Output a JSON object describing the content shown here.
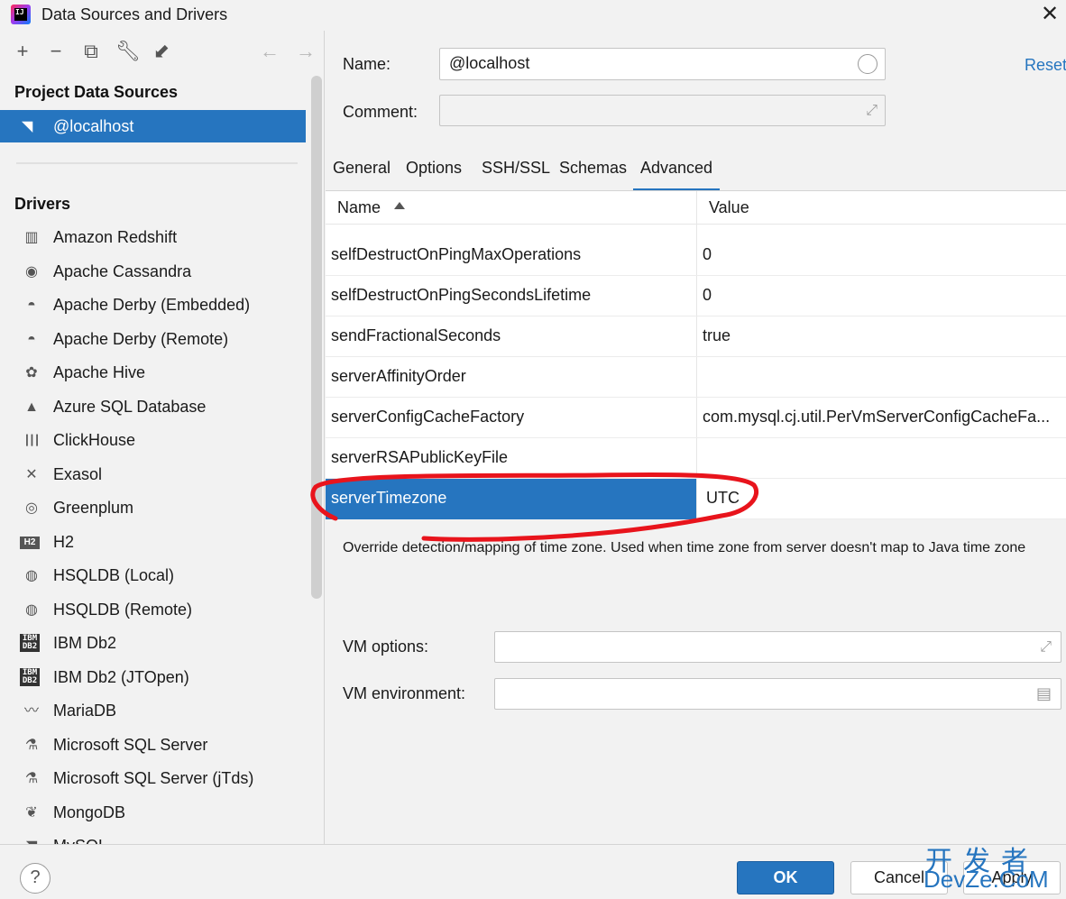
{
  "window": {
    "title": "Data Sources and Drivers",
    "close": "✕"
  },
  "sidebar": {
    "project_heading": "Project Data Sources",
    "selected_source": "@localhost",
    "drivers_heading": "Drivers",
    "drivers": [
      {
        "label": "Amazon Redshift",
        "icon": "redshift-icon",
        "glyph": "▥"
      },
      {
        "label": "Apache Cassandra",
        "icon": "cassandra-eye-icon",
        "glyph": "◉"
      },
      {
        "label": "Apache Derby (Embedded)",
        "icon": "derby-hat-icon",
        "glyph": "◓"
      },
      {
        "label": "Apache Derby (Remote)",
        "icon": "derby-hat-icon",
        "glyph": "◓"
      },
      {
        "label": "Apache Hive",
        "icon": "hive-bee-icon",
        "glyph": "✿"
      },
      {
        "label": "Azure SQL Database",
        "icon": "azure-icon",
        "glyph": "▲"
      },
      {
        "label": "ClickHouse",
        "icon": "clickhouse-bars-icon",
        "glyph": "┃┃┃"
      },
      {
        "label": "Exasol",
        "icon": "exasol-x-icon",
        "glyph": "✕"
      },
      {
        "label": "Greenplum",
        "icon": "greenplum-circle-icon",
        "glyph": "◎"
      },
      {
        "label": "H2",
        "icon": "h2-icon",
        "glyph": "H2"
      },
      {
        "label": "HSQLDB (Local)",
        "icon": "hsqldb-icon",
        "glyph": "◍"
      },
      {
        "label": "HSQLDB (Remote)",
        "icon": "hsqldb-icon",
        "glyph": "◍"
      },
      {
        "label": "IBM Db2",
        "icon": "ibm-db2-icon",
        "glyph": "IBM DB2"
      },
      {
        "label": "IBM Db2 (JTOpen)",
        "icon": "ibm-db2-icon",
        "glyph": "IBM DB2"
      },
      {
        "label": "MariaDB",
        "icon": "mariadb-seal-icon",
        "glyph": "〰"
      },
      {
        "label": "Microsoft SQL Server",
        "icon": "sqlserver-icon",
        "glyph": "⚗"
      },
      {
        "label": "Microsoft SQL Server (jTds)",
        "icon": "sqlserver-icon",
        "glyph": "⚗"
      },
      {
        "label": "MongoDB",
        "icon": "mongodb-leaf-icon",
        "glyph": "❦"
      },
      {
        "label": "MySQL",
        "icon": "mysql-dolphin-icon",
        "glyph": "◥"
      }
    ]
  },
  "form": {
    "name_label": "Name:",
    "name_value": "@localhost",
    "comment_label": "Comment:",
    "comment_value": "",
    "reset_link": "Reset"
  },
  "tabs": [
    "General",
    "Options",
    "SSH/SSL",
    "Schemas",
    "Advanced"
  ],
  "active_tab": "Advanced",
  "table": {
    "col_name": "Name",
    "col_value": "Value",
    "rows": [
      {
        "name": "selfDestructOnPingMaxOperations",
        "value": "0"
      },
      {
        "name": "selfDestructOnPingSecondsLifetime",
        "value": "0"
      },
      {
        "name": "sendFractionalSeconds",
        "value": "true"
      },
      {
        "name": "serverAffinityOrder",
        "value": ""
      },
      {
        "name": "serverConfigCacheFactory",
        "value": "com.mysql.cj.util.PerVmServerConfigCacheFa..."
      },
      {
        "name": "serverRSAPublicKeyFile",
        "value": ""
      },
      {
        "name": "serverTimezone",
        "value": "UTC"
      }
    ],
    "selected_row": "serverTimezone"
  },
  "description": "Override detection/mapping of time zone. Used when time zone from server doesn't map to Java time zone",
  "vm": {
    "options_label": "VM options:",
    "options_value": "",
    "environment_label": "VM environment:",
    "environment_value": ""
  },
  "buttons": {
    "help": "?",
    "ok": "OK",
    "cancel": "Cancel",
    "apply": "Apply"
  },
  "watermark": {
    "cn": "开发者",
    "en": "DevZe.CoM"
  },
  "colors": {
    "accent": "#2675bf",
    "annotation": "#e8141c"
  }
}
